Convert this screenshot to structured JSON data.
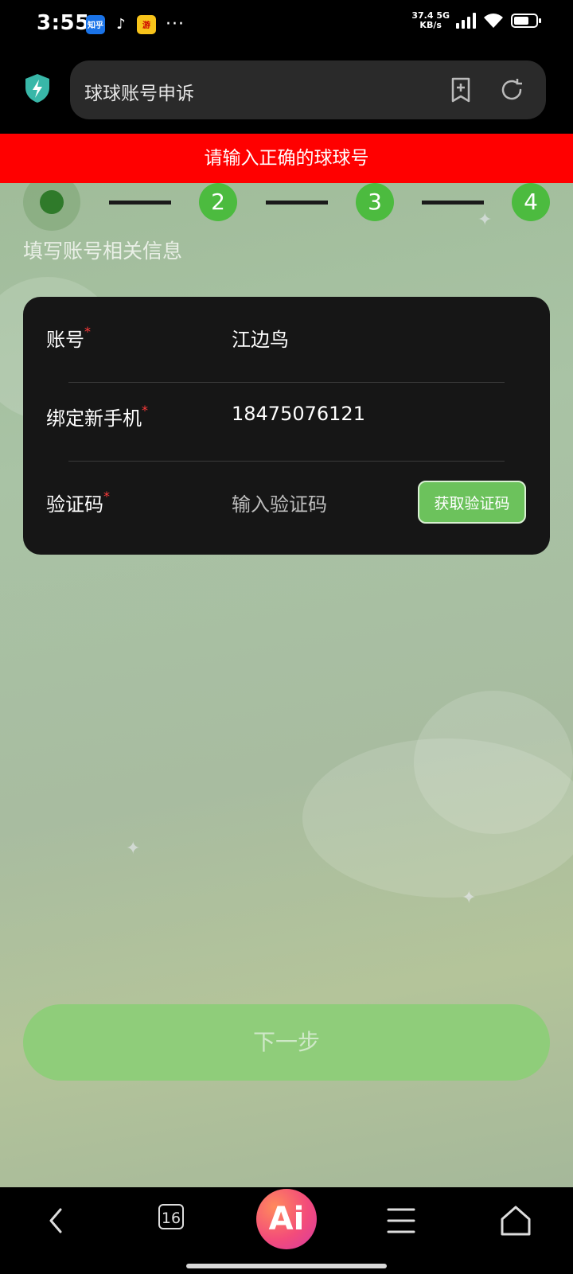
{
  "status_bar": {
    "time": "3:55",
    "apps": [
      "知乎",
      "TikTok",
      "游戏"
    ],
    "more": "···",
    "net_speed_value": "37.4",
    "net_speed_unit": "KB/s",
    "network_type": "5G"
  },
  "browser": {
    "address_text": "球球账号申诉",
    "shield_color": "#38b7a8"
  },
  "error_banner": "请输入正确的球球号",
  "steps": {
    "current": 1,
    "items": [
      "",
      "2",
      "3",
      "4"
    ]
  },
  "section_title": "填写账号相关信息",
  "form": {
    "account": {
      "label": "账号",
      "required": "*",
      "value": "江边鸟"
    },
    "phone": {
      "label": "绑定新手机",
      "required": "*",
      "value": "18475076121"
    },
    "code": {
      "label": "验证码",
      "required": "*",
      "placeholder": "输入验证码",
      "button": "获取验证码"
    }
  },
  "next_button": "下一步",
  "bottom_nav": {
    "tabs_count": "16",
    "ai_label": "Ai"
  },
  "colors": {
    "accent_green": "#4cbb3f",
    "error_red": "#ff0000"
  }
}
